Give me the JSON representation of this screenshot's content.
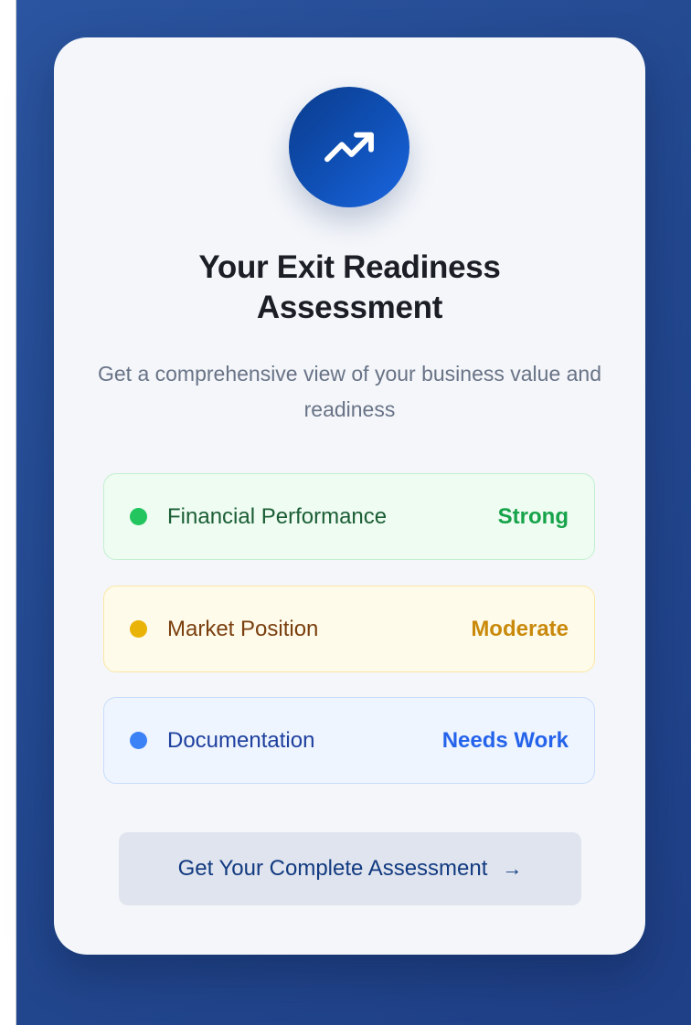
{
  "card": {
    "icon": "trending-up-icon",
    "title_line1": "Your Exit Readiness",
    "title_line2": "Assessment",
    "subtitle": "Get a comprehensive view of your business value and readiness"
  },
  "metrics": [
    {
      "label": "Financial Performance",
      "status": "Strong",
      "color": "#22c55e"
    },
    {
      "label": "Market Position",
      "status": "Moderate",
      "color": "#eab308"
    },
    {
      "label": "Documentation",
      "status": "Needs Work",
      "color": "#3b82f6"
    }
  ],
  "cta": {
    "label": "Get Your Complete Assessment",
    "arrow": "→"
  },
  "colors": {
    "background": "#23488f",
    "card": "#f4f6fa",
    "accent": "#0f4fb4"
  }
}
